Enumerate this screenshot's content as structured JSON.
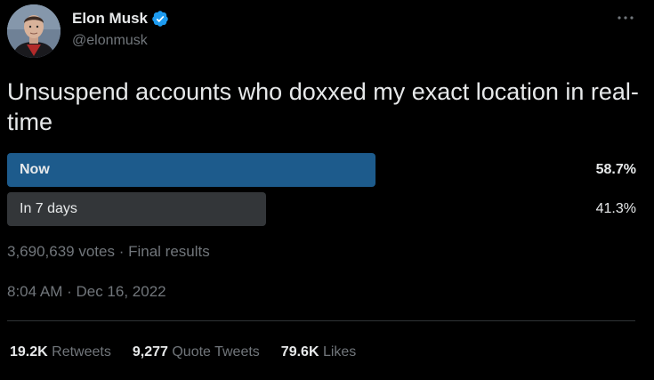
{
  "author": {
    "display_name": "Elon Musk",
    "handle": "@elonmusk",
    "verified_icon": "verified-badge-icon",
    "avatar": "avatar-photo"
  },
  "menu": {
    "icon": "more-horizontal-icon",
    "label": "···"
  },
  "tweet": {
    "text": "Unsuspend accounts who doxxed my exact location in real-time"
  },
  "poll": {
    "options": [
      {
        "label": "Now",
        "percent_text": "58.7%",
        "percent": 58.7,
        "winner": true
      },
      {
        "label": "In 7 days",
        "percent_text": "41.3%",
        "percent": 41.3,
        "winner": false
      }
    ],
    "meta": "3,690,639 votes · Final results"
  },
  "timestamp": "8:04 AM · Dec 16, 2022",
  "stats": {
    "retweets": {
      "count": "19.2K",
      "label": "Retweets"
    },
    "quote_tweets": {
      "count": "9,277",
      "label": "Quote Tweets"
    },
    "likes": {
      "count": "79.6K",
      "label": "Likes"
    }
  },
  "colors": {
    "background": "#000000",
    "text": "#e7e9ea",
    "secondary": "#71767b",
    "winner_bar": "#1d5b8c",
    "other_bar": "#333639",
    "verified": "#1d9bf0"
  }
}
